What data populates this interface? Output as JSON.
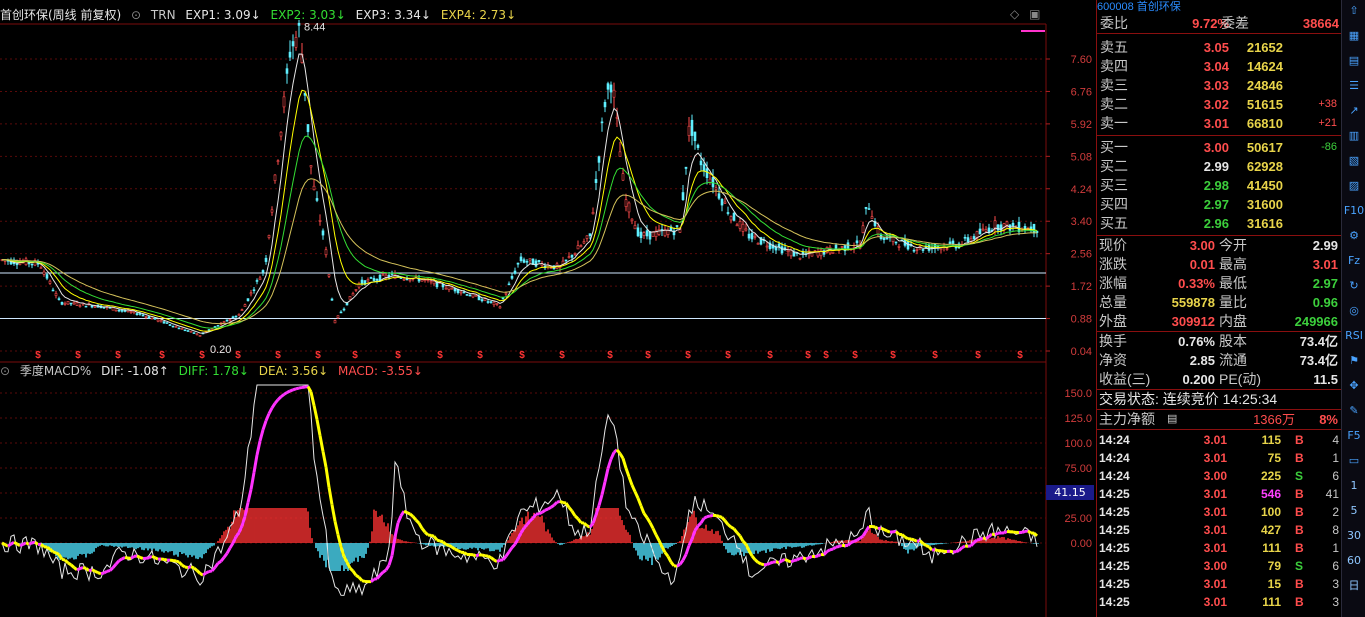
{
  "header": {
    "stock_title": "首创环保(周线 前复权)",
    "indicator": "TRN",
    "exp1": "EXP1: 3.09↓",
    "exp2": "EXP2: 3.03↓",
    "exp3": "EXP3: 3.34↓",
    "exp4": "EXP4: 2.73↓"
  },
  "price_axis": [
    "7.60",
    "6.76",
    "5.92",
    "5.08",
    "4.24",
    "3.40",
    "2.56",
    "1.72",
    "0.88",
    "0.04"
  ],
  "price_annotations": {
    "high": "8.44",
    "low": "0.20"
  },
  "macd_header": {
    "name": "季度MACD%",
    "dif": "DIF: -1.08↑",
    "diff": "DIFF: 1.78↓",
    "dea": "DEA: 3.56↓",
    "macd": "MACD: -3.55↓"
  },
  "macd_axis": [
    "150.0",
    "125.0",
    "100.0",
    "75.00",
    "50.00",
    "25.00",
    "0.00"
  ],
  "macd_current": "41.15",
  "panel": {
    "top_code": "600008 首创环保",
    "weibi_label": "委比",
    "weibi_value": "9.72%",
    "weicha_label": "委差",
    "weicha_value": "38664",
    "asks": [
      {
        "label": "卖五",
        "price": "3.05",
        "vol": "21652",
        "chg": ""
      },
      {
        "label": "卖四",
        "price": "3.04",
        "vol": "14624",
        "chg": ""
      },
      {
        "label": "卖三",
        "price": "3.03",
        "vol": "24846",
        "chg": ""
      },
      {
        "label": "卖二",
        "price": "3.02",
        "vol": "51615",
        "chg": "+38"
      },
      {
        "label": "卖一",
        "price": "3.01",
        "vol": "66810",
        "chg": "+21"
      }
    ],
    "bids": [
      {
        "label": "买一",
        "price": "3.00",
        "vol": "50617",
        "chg": "-86"
      },
      {
        "label": "买二",
        "price": "2.99",
        "vol": "62928",
        "chg": ""
      },
      {
        "label": "买三",
        "price": "2.98",
        "vol": "41450",
        "chg": ""
      },
      {
        "label": "买四",
        "price": "2.97",
        "vol": "31600",
        "chg": ""
      },
      {
        "label": "买五",
        "price": "2.96",
        "vol": "31616",
        "chg": ""
      }
    ],
    "quote": [
      {
        "l1": "现价",
        "v1": "3.00",
        "l2": "今开",
        "v2": "2.99"
      },
      {
        "l1": "涨跌",
        "v1": "0.01",
        "l2": "最高",
        "v2": "3.01"
      },
      {
        "l1": "涨幅",
        "v1": "0.33%",
        "l2": "最低",
        "v2": "2.97"
      },
      {
        "l1": "总量",
        "v1": "559878",
        "l2": "量比",
        "v2": "0.96"
      },
      {
        "l1": "外盘",
        "v1": "309912",
        "l2": "内盘",
        "v2": "249966"
      }
    ],
    "fund": [
      {
        "l1": "换手",
        "v1": "0.76%",
        "l2": "股本",
        "v2": "73.4亿"
      },
      {
        "l1": "净资",
        "v1": "2.85",
        "l2": "流通",
        "v2": "73.4亿"
      },
      {
        "l1": "收益(三)",
        "v1": "0.200",
        "l2": "PE(动)",
        "v2": "11.5"
      }
    ],
    "trade_status": "交易状态: 连续竞价 14:25:34",
    "main_fund_label": "主力净额",
    "main_fund_value": "1366万",
    "main_fund_pct": "8%",
    "ticks": [
      {
        "t": "14:24",
        "p": "3.01",
        "v": "115",
        "s": "B",
        "n": "4"
      },
      {
        "t": "14:24",
        "p": "3.01",
        "v": "75",
        "s": "B",
        "n": "1"
      },
      {
        "t": "14:24",
        "p": "3.00",
        "v": "225",
        "s": "S",
        "n": "6"
      },
      {
        "t": "14:25",
        "p": "3.01",
        "v": "546",
        "s": "B",
        "n": "41"
      },
      {
        "t": "14:25",
        "p": "3.01",
        "v": "100",
        "s": "B",
        "n": "2"
      },
      {
        "t": "14:25",
        "p": "3.01",
        "v": "427",
        "s": "B",
        "n": "8"
      },
      {
        "t": "14:25",
        "p": "3.01",
        "v": "111",
        "s": "B",
        "n": "1"
      },
      {
        "t": "14:25",
        "p": "3.00",
        "v": "79",
        "s": "S",
        "n": "6"
      },
      {
        "t": "14:25",
        "p": "3.01",
        "v": "15",
        "s": "B",
        "n": "3"
      },
      {
        "t": "14:25",
        "p": "3.01",
        "v": "111",
        "s": "B",
        "n": "3"
      }
    ]
  },
  "tools": [
    "up-arrow-icon",
    "grid-icon",
    "table-icon",
    "list-icon",
    "line-chart-icon",
    "candle-icon",
    "depth-icon",
    "fund-icon",
    "f10-icon",
    "gear-icon",
    "fiz-icon",
    "cycle-icon",
    "circle-icon",
    "rsi-icon",
    "flag-icon",
    "move-icon",
    "pen-icon",
    "f5-icon",
    "monitor-icon",
    "1",
    "5",
    "30",
    "60",
    "日"
  ],
  "colors": {
    "up": "#ff4d4d",
    "down": "#3ccf3c",
    "ema1": "#e6e6e6",
    "ema2": "#ffff00",
    "ema3": "#33dd33",
    "ema4": "#d4c25a",
    "grid": "#5a0a0a"
  }
}
